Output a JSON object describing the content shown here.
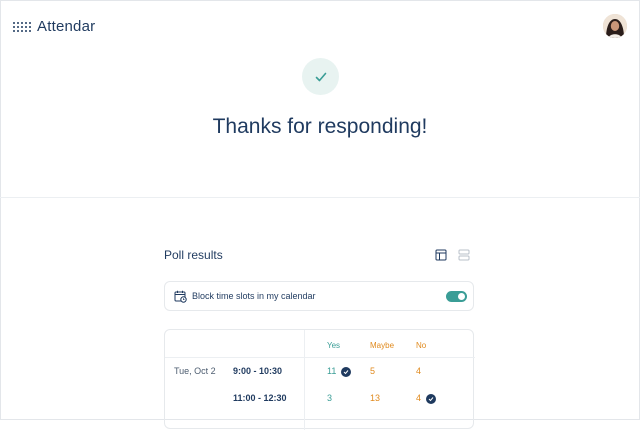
{
  "header": {
    "app_name": "Attendar",
    "logo_icon": "dot-grid-logo-icon",
    "avatar_icon": "user-avatar-icon"
  },
  "confirmation": {
    "icon": "checkmark-icon",
    "title": "Thanks for responding!"
  },
  "poll": {
    "title": "Poll results",
    "view_icons": [
      "table-view-icon",
      "list-view-icon"
    ],
    "block_label": "Block time slots in my calendar",
    "block_toggle_on": true,
    "columns": {
      "yes": "Yes",
      "maybe": "Maybe",
      "no": "No"
    },
    "rows": [
      {
        "date": "Tue, Oct 2",
        "time": "9:00 - 10:30",
        "yes": "11",
        "maybe": "5",
        "no": "4",
        "my_vote": "yes"
      },
      {
        "date": "",
        "time": "11:00 - 12:30",
        "yes": "3",
        "maybe": "13",
        "no": "4",
        "my_vote": "no"
      }
    ]
  },
  "colors": {
    "primary": "#1f3a5f",
    "accent": "#3a9d96",
    "warning": "#e08a1e"
  }
}
